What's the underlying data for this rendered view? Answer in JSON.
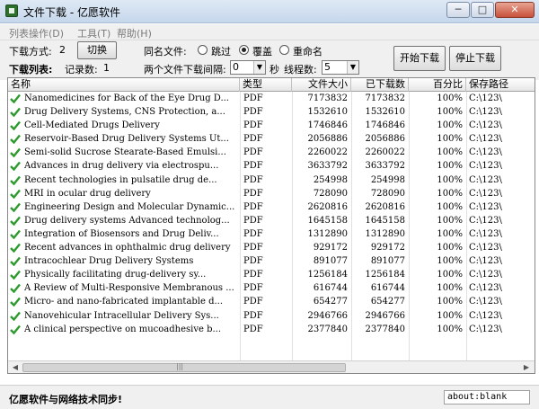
{
  "window": {
    "title": "文件下载 - 亿愿软件",
    "min": "─",
    "max": "□",
    "close": "✕"
  },
  "menu": [
    "列表操作(D)",
    "工具(T)",
    "帮助(H)"
  ],
  "toolbar": {
    "mode_label": "下载方式:",
    "mode_value": "2",
    "switch_button": "切换",
    "list_label": "下载列表:",
    "records_label": "记录数:",
    "records_value": "1",
    "same_name_label": "同名文件:",
    "radio_skip": "跳过",
    "radio_overwrite": "覆盖",
    "radio_rename": "重命名",
    "interval_label": "两个文件下载间隔:",
    "interval_value": "0",
    "seconds_label": "秒",
    "threads_label": "线程数:",
    "threads_value": "5",
    "start_button": "开始下载",
    "stop_button": "停止下载"
  },
  "table": {
    "columns": [
      "名称",
      "类型",
      "文件大小",
      "已下载数",
      "百分比",
      "保存路径"
    ],
    "rows": [
      [
        "Nanomedicines for Back of the Eye Drug D...",
        "PDF",
        "7173832",
        "7173832",
        "100%",
        "C:\\123\\"
      ],
      [
        "Drug Delivery Systems, CNS Protection, a...",
        "PDF",
        "1532610",
        "1532610",
        "100%",
        "C:\\123\\"
      ],
      [
        "Cell-Mediated Drugs Delivery",
        "PDF",
        "1746846",
        "1746846",
        "100%",
        "C:\\123\\"
      ],
      [
        "Reservoir-Based Drug Delivery Systems Ut...",
        "PDF",
        "2056886",
        "2056886",
        "100%",
        "C:\\123\\"
      ],
      [
        "Semi-solid Sucrose Stearate-Based Emulsi...",
        "PDF",
        "2260022",
        "2260022",
        "100%",
        "C:\\123\\"
      ],
      [
        "Advances in drug delivery via electrospu...",
        "PDF",
        "3633792",
        "3633792",
        "100%",
        "C:\\123\\"
      ],
      [
        "Recent technologies in pulsatile drug de...",
        "PDF",
        "254998",
        "254998",
        "100%",
        "C:\\123\\"
      ],
      [
        "MRI in ocular drug delivery",
        "PDF",
        "728090",
        "728090",
        "100%",
        "C:\\123\\"
      ],
      [
        "Engineering Design and Molecular Dynamic...",
        "PDF",
        "2620816",
        "2620816",
        "100%",
        "C:\\123\\"
      ],
      [
        "Drug delivery systems Advanced technolog...",
        "PDF",
        "1645158",
        "1645158",
        "100%",
        "C:\\123\\"
      ],
      [
        "Integration of Biosensors and Drug Deliv...",
        "PDF",
        "1312890",
        "1312890",
        "100%",
        "C:\\123\\"
      ],
      [
        "Recent advances in ophthalmic drug delivery",
        "PDF",
        "929172",
        "929172",
        "100%",
        "C:\\123\\"
      ],
      [
        "Intracochlear Drug Delivery Systems",
        "PDF",
        "891077",
        "891077",
        "100%",
        "C:\\123\\"
      ],
      [
        "Physically facilitating drug-delivery sy...",
        "PDF",
        "1256184",
        "1256184",
        "100%",
        "C:\\123\\"
      ],
      [
        "A Review of Multi-Responsive Membranous ...",
        "PDF",
        "616744",
        "616744",
        "100%",
        "C:\\123\\"
      ],
      [
        "Micro- and nano-fabricated implantable d...",
        "PDF",
        "654277",
        "654277",
        "100%",
        "C:\\123\\"
      ],
      [
        "Nanovehicular Intracellular Delivery Sys...",
        "PDF",
        "2946766",
        "2946766",
        "100%",
        "C:\\123\\"
      ],
      [
        "A clinical perspective on mucoadhesive b...",
        "PDF",
        "2377840",
        "2377840",
        "100%",
        "C:\\123\\"
      ]
    ]
  },
  "scrollbar": {
    "left": "◀",
    "right": "▶",
    "grip": "|||"
  },
  "status": {
    "left": "亿愿软件与网络技术同步!",
    "right": "about:blank"
  },
  "colors": {
    "check": "#2e9a2e",
    "titlebar": "#c6d7ec"
  }
}
